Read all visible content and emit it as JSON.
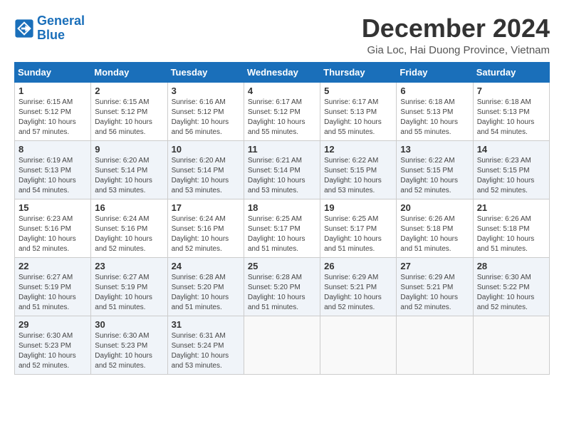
{
  "logo": {
    "text_general": "General",
    "text_blue": "Blue"
  },
  "header": {
    "title": "December 2024",
    "subtitle": "Gia Loc, Hai Duong Province, Vietnam"
  },
  "weekdays": [
    "Sunday",
    "Monday",
    "Tuesday",
    "Wednesday",
    "Thursday",
    "Friday",
    "Saturday"
  ],
  "weeks": [
    [
      {
        "day": "1",
        "sunrise": "6:15 AM",
        "sunset": "5:12 PM",
        "daylight": "10 hours and 57 minutes."
      },
      {
        "day": "2",
        "sunrise": "6:15 AM",
        "sunset": "5:12 PM",
        "daylight": "10 hours and 56 minutes."
      },
      {
        "day": "3",
        "sunrise": "6:16 AM",
        "sunset": "5:12 PM",
        "daylight": "10 hours and 56 minutes."
      },
      {
        "day": "4",
        "sunrise": "6:17 AM",
        "sunset": "5:12 PM",
        "daylight": "10 hours and 55 minutes."
      },
      {
        "day": "5",
        "sunrise": "6:17 AM",
        "sunset": "5:13 PM",
        "daylight": "10 hours and 55 minutes."
      },
      {
        "day": "6",
        "sunrise": "6:18 AM",
        "sunset": "5:13 PM",
        "daylight": "10 hours and 55 minutes."
      },
      {
        "day": "7",
        "sunrise": "6:18 AM",
        "sunset": "5:13 PM",
        "daylight": "10 hours and 54 minutes."
      }
    ],
    [
      {
        "day": "8",
        "sunrise": "6:19 AM",
        "sunset": "5:13 PM",
        "daylight": "10 hours and 54 minutes."
      },
      {
        "day": "9",
        "sunrise": "6:20 AM",
        "sunset": "5:14 PM",
        "daylight": "10 hours and 53 minutes."
      },
      {
        "day": "10",
        "sunrise": "6:20 AM",
        "sunset": "5:14 PM",
        "daylight": "10 hours and 53 minutes."
      },
      {
        "day": "11",
        "sunrise": "6:21 AM",
        "sunset": "5:14 PM",
        "daylight": "10 hours and 53 minutes."
      },
      {
        "day": "12",
        "sunrise": "6:22 AM",
        "sunset": "5:15 PM",
        "daylight": "10 hours and 53 minutes."
      },
      {
        "day": "13",
        "sunrise": "6:22 AM",
        "sunset": "5:15 PM",
        "daylight": "10 hours and 52 minutes."
      },
      {
        "day": "14",
        "sunrise": "6:23 AM",
        "sunset": "5:15 PM",
        "daylight": "10 hours and 52 minutes."
      }
    ],
    [
      {
        "day": "15",
        "sunrise": "6:23 AM",
        "sunset": "5:16 PM",
        "daylight": "10 hours and 52 minutes."
      },
      {
        "day": "16",
        "sunrise": "6:24 AM",
        "sunset": "5:16 PM",
        "daylight": "10 hours and 52 minutes."
      },
      {
        "day": "17",
        "sunrise": "6:24 AM",
        "sunset": "5:16 PM",
        "daylight": "10 hours and 52 minutes."
      },
      {
        "day": "18",
        "sunrise": "6:25 AM",
        "sunset": "5:17 PM",
        "daylight": "10 hours and 51 minutes."
      },
      {
        "day": "19",
        "sunrise": "6:25 AM",
        "sunset": "5:17 PM",
        "daylight": "10 hours and 51 minutes."
      },
      {
        "day": "20",
        "sunrise": "6:26 AM",
        "sunset": "5:18 PM",
        "daylight": "10 hours and 51 minutes."
      },
      {
        "day": "21",
        "sunrise": "6:26 AM",
        "sunset": "5:18 PM",
        "daylight": "10 hours and 51 minutes."
      }
    ],
    [
      {
        "day": "22",
        "sunrise": "6:27 AM",
        "sunset": "5:19 PM",
        "daylight": "10 hours and 51 minutes."
      },
      {
        "day": "23",
        "sunrise": "6:27 AM",
        "sunset": "5:19 PM",
        "daylight": "10 hours and 51 minutes."
      },
      {
        "day": "24",
        "sunrise": "6:28 AM",
        "sunset": "5:20 PM",
        "daylight": "10 hours and 51 minutes."
      },
      {
        "day": "25",
        "sunrise": "6:28 AM",
        "sunset": "5:20 PM",
        "daylight": "10 hours and 51 minutes."
      },
      {
        "day": "26",
        "sunrise": "6:29 AM",
        "sunset": "5:21 PM",
        "daylight": "10 hours and 52 minutes."
      },
      {
        "day": "27",
        "sunrise": "6:29 AM",
        "sunset": "5:21 PM",
        "daylight": "10 hours and 52 minutes."
      },
      {
        "day": "28",
        "sunrise": "6:30 AM",
        "sunset": "5:22 PM",
        "daylight": "10 hours and 52 minutes."
      }
    ],
    [
      {
        "day": "29",
        "sunrise": "6:30 AM",
        "sunset": "5:23 PM",
        "daylight": "10 hours and 52 minutes."
      },
      {
        "day": "30",
        "sunrise": "6:30 AM",
        "sunset": "5:23 PM",
        "daylight": "10 hours and 52 minutes."
      },
      {
        "day": "31",
        "sunrise": "6:31 AM",
        "sunset": "5:24 PM",
        "daylight": "10 hours and 53 minutes."
      },
      null,
      null,
      null,
      null
    ]
  ]
}
